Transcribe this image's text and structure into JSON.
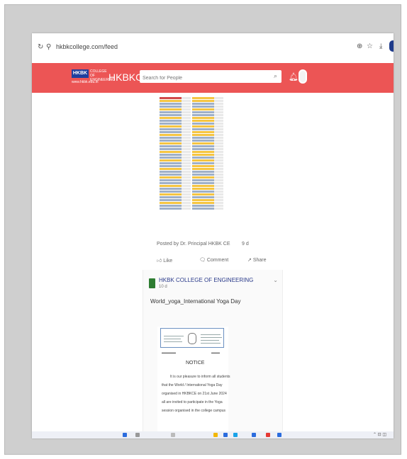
{
  "browser": {
    "url": "hkbkcollege.com/feed",
    "reload_icon": "reload-icon",
    "site_info_icon": "site-info-icon"
  },
  "header": {
    "logo_text": "HKBK",
    "logo_subtitle": "COLLEGE OF ENGINEERING",
    "logo_url": "www.hkbk.edu.in",
    "site_name": "HKBKCE",
    "search_placeholder": "Search for People",
    "brand_color": "#ec5555"
  },
  "post1": {
    "posted_by": "Posted by Dr. Principal HKBK CE",
    "date": "9 d",
    "like_label": "Like",
    "comment_label": "Comment",
    "share_label": "Share"
  },
  "post2": {
    "college_name": "HKBK COLLEGE OF ENGINEERING",
    "date": "10 d",
    "title": "World_yoga_International Yoga Day",
    "notice_heading": "NOTICE",
    "notice_lines": [
      "It is our pleasure to inform all students",
      "that the World / International Yoga Day",
      "organised in HKBKCE on 21st June 2024",
      "all are invited to participate in the Yoga",
      "session organised in the college campus"
    ]
  },
  "colors": {
    "accent": "#ec5555",
    "timetable_highlight": "#f5c542",
    "timetable_header": "#d14a4a",
    "college_icon": "#2e7d32"
  }
}
